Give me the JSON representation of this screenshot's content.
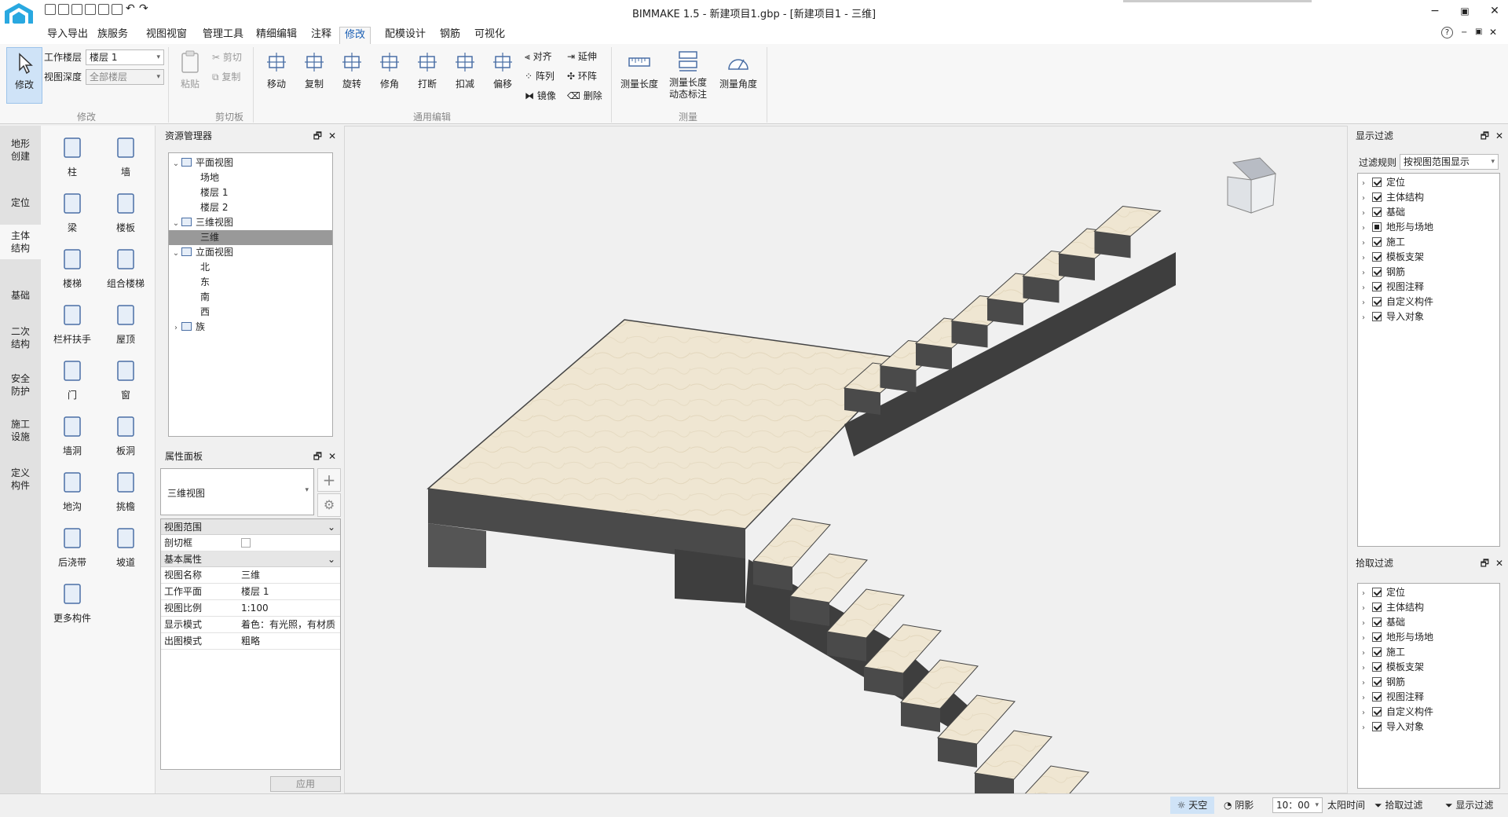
{
  "window": {
    "title": "BIMMAKE 1.5 - 新建项目1.gbp - [新建项目1 - 三维]"
  },
  "menu": {
    "tabs": [
      "导入导出",
      "族服务",
      "视图视窗",
      "管理工具",
      "精细编辑",
      "注释",
      "修改",
      "配模设计",
      "钢筋",
      "可视化"
    ],
    "active": "修改"
  },
  "ribbon": {
    "modify_label": "修改",
    "work_floor_label": "工作楼层",
    "work_floor_value": "楼层 1",
    "view_depth_label": "视图深度",
    "view_depth_value": "全部楼层",
    "paste": "粘贴",
    "cut": "剪切",
    "copy_small": "复制",
    "tools": [
      "移动",
      "复制",
      "旋转",
      "修角",
      "打断",
      "扣减",
      "偏移"
    ],
    "small_tools_a": [
      "对齐",
      "阵列",
      "镜像"
    ],
    "small_tools_b": [
      "延伸",
      "环阵",
      "删除"
    ],
    "measure": [
      "测量长度",
      "测量长度动态标注",
      "测量角度"
    ],
    "group_labels": {
      "modify": "修改",
      "clipboard": "剪切板",
      "edit": "通用编辑",
      "measure": "测量"
    }
  },
  "left_tabs": [
    "地形创建",
    "定位",
    "主体结构",
    "基础",
    "二次结构",
    "安全防护",
    "施工设施",
    "定义构件"
  ],
  "left_active": "主体结构",
  "components": [
    "柱",
    "墙",
    "梁",
    "楼板",
    "楼梯",
    "组合楼梯",
    "栏杆扶手",
    "屋顶",
    "门",
    "窗",
    "墙洞",
    "板洞",
    "地沟",
    "挑檐",
    "后浇带",
    "坡道",
    "更多构件"
  ],
  "resource_manager": {
    "title": "资源管理器",
    "tree": [
      {
        "label": "平面视图",
        "level": 0,
        "arrow": "v",
        "icon": true
      },
      {
        "label": "场地",
        "level": 1
      },
      {
        "label": "楼层 1",
        "level": 1
      },
      {
        "label": "楼层 2",
        "level": 1
      },
      {
        "label": "三维视图",
        "level": 0,
        "arrow": "v",
        "icon": true
      },
      {
        "label": "三维",
        "level": 1,
        "selected": true
      },
      {
        "label": "立面视图",
        "level": 0,
        "arrow": "v",
        "icon": true
      },
      {
        "label": "北",
        "level": 1
      },
      {
        "label": "东",
        "level": 1
      },
      {
        "label": "南",
        "level": 1
      },
      {
        "label": "西",
        "level": 1
      },
      {
        "label": "族",
        "level": 0,
        "arrow": ">",
        "icon": true
      }
    ]
  },
  "properties": {
    "title": "属性面板",
    "type_value": "三维视图",
    "section_view_range": "视图范围",
    "clip_box_label": "剖切框",
    "section_basic": "基本属性",
    "rows": [
      {
        "k": "视图名称",
        "v": "三维"
      },
      {
        "k": "工作平面",
        "v": "楼层 1"
      },
      {
        "k": "视图比例",
        "v": "1:100"
      },
      {
        "k": "显示模式",
        "v": "着色：有光照，有材质"
      },
      {
        "k": "出图模式",
        "v": "粗略"
      }
    ],
    "apply": "应用"
  },
  "display_filter": {
    "title": "显示过滤",
    "rule_label": "过滤规则",
    "rule_value": "按视图范围显示",
    "items": [
      {
        "label": "定位",
        "state": "on"
      },
      {
        "label": "主体结构",
        "state": "on"
      },
      {
        "label": "基础",
        "state": "on"
      },
      {
        "label": "地形与场地",
        "state": "part"
      },
      {
        "label": "施工",
        "state": "on"
      },
      {
        "label": "模板支架",
        "state": "on"
      },
      {
        "label": "钢筋",
        "state": "on"
      },
      {
        "label": "视图注释",
        "state": "on"
      },
      {
        "label": "自定义构件",
        "state": "on"
      },
      {
        "label": "导入对象",
        "state": "on"
      }
    ]
  },
  "pick_filter": {
    "title": "拾取过滤",
    "items": [
      "定位",
      "主体结构",
      "基础",
      "地形与场地",
      "施工",
      "模板支架",
      "钢筋",
      "视图注释",
      "自定义构件",
      "导入对象"
    ]
  },
  "status": {
    "sky": "天空",
    "shadow": "阴影",
    "time": "10：00",
    "sun_time": "太阳时间",
    "pick_filter": "拾取过滤",
    "display_filter": "显示过滤"
  },
  "colors": {
    "accent": "#1a5fb4",
    "tread": "#efe6d2",
    "concrete": "#4a4a4a",
    "selected": "#999999"
  }
}
